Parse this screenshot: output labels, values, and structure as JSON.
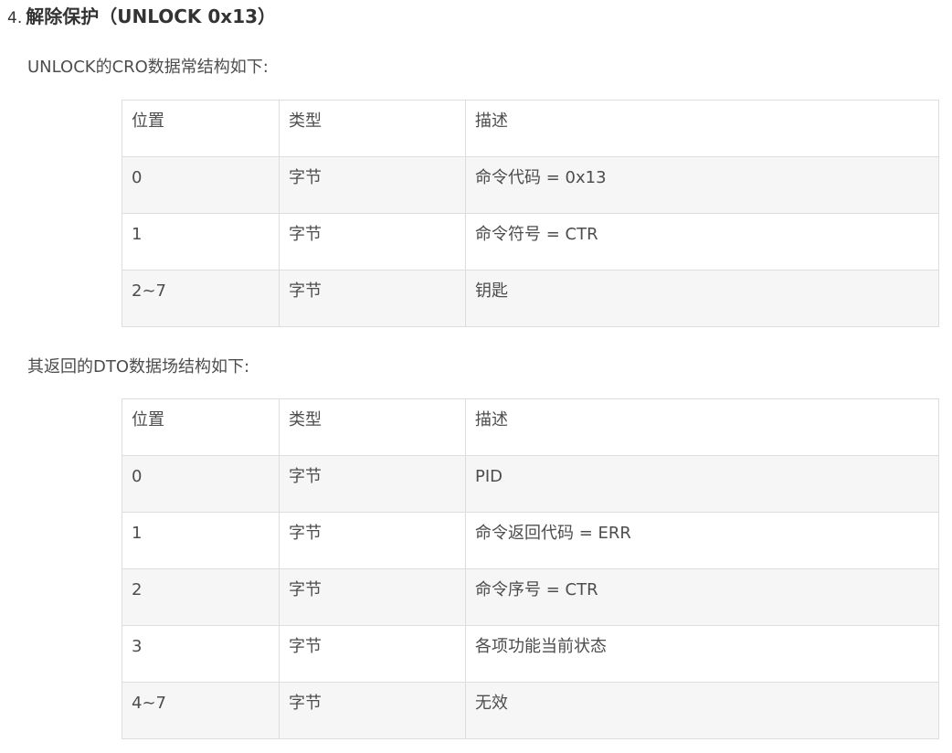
{
  "heading": {
    "number": "4.",
    "title": "解除保护（UNLOCK 0x13）"
  },
  "cro_intro": "UNLOCK的CRO数据常结构如下:",
  "cro_table": {
    "headers": [
      "位置",
      "类型",
      "描述"
    ],
    "rows": [
      [
        "0",
        "字节",
        "命令代码 = 0x13"
      ],
      [
        "1",
        "字节",
        "命令符号 = CTR"
      ],
      [
        "2~7",
        "字节",
        "钥匙"
      ]
    ]
  },
  "dto_intro": "其返回的DTO数据场结构如下:",
  "dto_table": {
    "headers": [
      "位置",
      "类型",
      "描述"
    ],
    "rows": [
      [
        "0",
        "字节",
        "PID"
      ],
      [
        "1",
        "字节",
        "命令返回代码 = ERR"
      ],
      [
        "2",
        "字节",
        "命令序号 = CTR"
      ],
      [
        "3",
        "字节",
        "各项功能当前状态"
      ],
      [
        "4~7",
        "字节",
        "无效"
      ]
    ]
  }
}
